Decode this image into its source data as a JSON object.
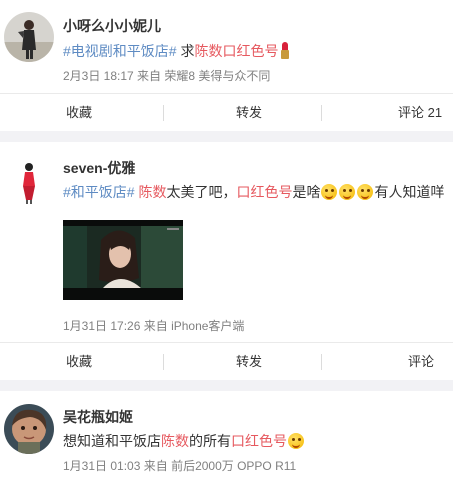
{
  "posts": [
    {
      "user": "小呀么小小妮儿",
      "content": {
        "tag": "#电视剧和平饭店#",
        "t1": " 求",
        "red1": "陈数口红色号"
      },
      "meta": {
        "time": "2月3日 18:17",
        "from_prefix": " 来自 ",
        "source": "荣耀8 美得与众不同"
      },
      "actions": {
        "fav": "收藏",
        "repost": "转发",
        "comment": "评论 21"
      }
    },
    {
      "user": "seven-优雅",
      "content": {
        "tag": "#和平饭店#",
        "t1": " ",
        "red1": "陈数",
        "t2": "太美了吧，",
        "red2": "口红色号",
        "t3": "是啥",
        "t4": "有人知道咩"
      },
      "image_caption": "video still",
      "meta": {
        "time": "1月31日 17:26",
        "from_prefix": " 来自 ",
        "source": "iPhone客户端"
      },
      "actions": {
        "fav": "收藏",
        "repost": "转发",
        "comment": "评论"
      }
    },
    {
      "user": "吴花瓶如姬",
      "content": {
        "t1": "想知道和平饭店",
        "red1": "陈数",
        "t2": "的所有",
        "red2": "口红色号"
      },
      "meta": {
        "time": "1月31日 01:03",
        "from_prefix": " 来自 ",
        "source": "前后2000万 OPPO R11"
      }
    }
  ],
  "colors": {
    "topic": "#5e8bc3",
    "highlight": "#e6595f",
    "meta": "#808080"
  },
  "icons": [
    "lipstick-icon",
    "grin-emoji-icon"
  ]
}
